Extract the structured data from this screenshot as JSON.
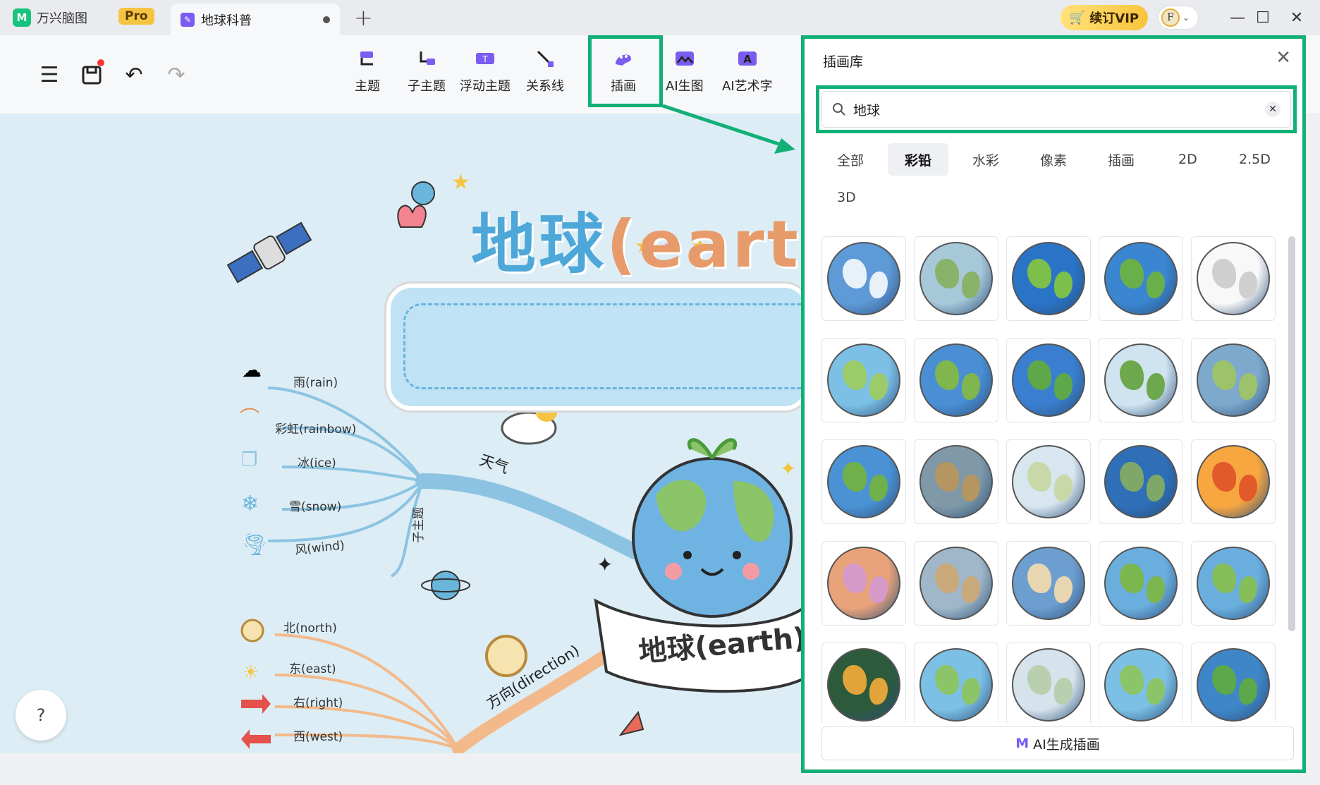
{
  "titlebar": {
    "app_name": "万兴脑图",
    "pro_badge": "Pro",
    "doc_tab": "地球科普",
    "vip_label": "续订VIP",
    "avatar_initial": "F"
  },
  "toolbar": {
    "tools": [
      {
        "name": "topic",
        "label": "主题"
      },
      {
        "name": "subtopic",
        "label": "子主题"
      },
      {
        "name": "floating-topic",
        "label": "浮动主题"
      },
      {
        "name": "relation-line",
        "label": "关系线"
      },
      {
        "name": "illustration",
        "label": "插画"
      },
      {
        "name": "ai-image",
        "label": "AI生图"
      },
      {
        "name": "ai-art-text",
        "label": "AI艺术字"
      }
    ]
  },
  "canvas": {
    "title_main": "地球",
    "title_paren": "(eart",
    "center_label": "地球(earth)",
    "weather_branch": "天气",
    "subtopic_label": "子主题",
    "direction_branch": "方向(direction)",
    "weather_items": [
      "雨(rain)",
      "彩虹(rainbow)",
      "冰(ice)",
      "雪(snow)",
      "风(wind)"
    ],
    "direction_items": [
      "北(north)",
      "东(east)",
      "右(right)",
      "西(west)"
    ],
    "help": "?"
  },
  "panel": {
    "title": "插画库",
    "search_value": "地球",
    "categories": [
      "全部",
      "彩铅",
      "水彩",
      "像素",
      "插画",
      "2D",
      "2.5D",
      "3D"
    ],
    "active_category": "彩铅",
    "ai_button": "AI生成插画",
    "colors": {
      "highlight": "#12b076",
      "ocean": "#4a8fd4",
      "land": "#6fb04a"
    }
  }
}
